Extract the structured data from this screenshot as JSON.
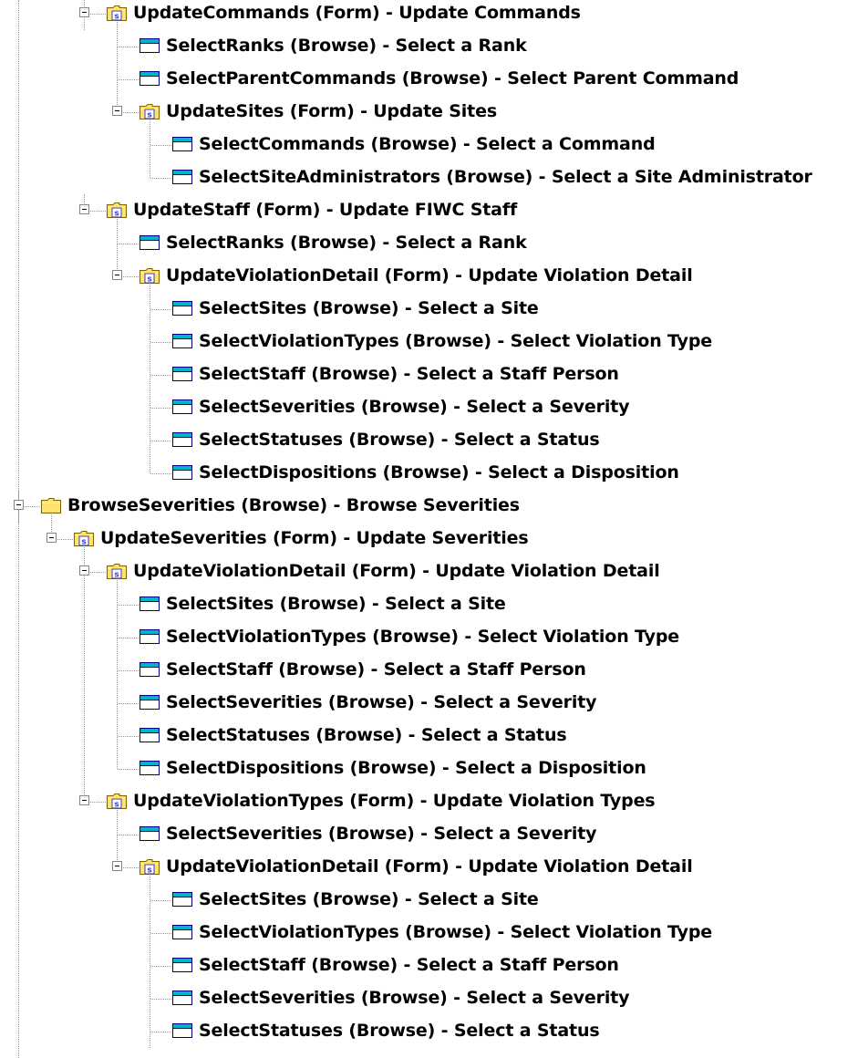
{
  "tree": {
    "nodes": [
      {
        "depth": 3,
        "icon": "form",
        "expanded": true,
        "last": false,
        "label": "UpdateCommands (Form) - Update Commands"
      },
      {
        "depth": 4,
        "icon": "browse",
        "expanded": false,
        "last": false,
        "label": "SelectRanks (Browse) - Select a Rank"
      },
      {
        "depth": 4,
        "icon": "browse",
        "expanded": false,
        "last": false,
        "label": "SelectParentCommands (Browse) - Select Parent Command"
      },
      {
        "depth": 4,
        "icon": "form",
        "expanded": true,
        "last": true,
        "label": "UpdateSites (Form) - Update Sites"
      },
      {
        "depth": 5,
        "icon": "browse",
        "expanded": false,
        "last": false,
        "label": "SelectCommands (Browse) - Select a Command"
      },
      {
        "depth": 5,
        "icon": "browse",
        "expanded": false,
        "last": true,
        "label": "SelectSiteAdministrators (Browse) - Select a Site Administrator"
      },
      {
        "depth": 3,
        "icon": "form",
        "expanded": true,
        "last": true,
        "label": "UpdateStaff (Form) - Update FIWC Staff"
      },
      {
        "depth": 4,
        "icon": "browse",
        "expanded": false,
        "last": false,
        "label": "SelectRanks (Browse) - Select a Rank"
      },
      {
        "depth": 4,
        "icon": "form",
        "expanded": true,
        "last": true,
        "label": "UpdateViolationDetail (Form) - Update Violation Detail"
      },
      {
        "depth": 5,
        "icon": "browse",
        "expanded": false,
        "last": false,
        "label": "SelectSites (Browse) - Select a Site"
      },
      {
        "depth": 5,
        "icon": "browse",
        "expanded": false,
        "last": false,
        "label": "SelectViolationTypes (Browse) - Select Violation Type"
      },
      {
        "depth": 5,
        "icon": "browse",
        "expanded": false,
        "last": false,
        "label": "SelectStaff (Browse) - Select a Staff Person"
      },
      {
        "depth": 5,
        "icon": "browse",
        "expanded": false,
        "last": false,
        "label": "SelectSeverities (Browse) - Select a Severity"
      },
      {
        "depth": 5,
        "icon": "browse",
        "expanded": false,
        "last": false,
        "label": "SelectStatuses (Browse) - Select a Status"
      },
      {
        "depth": 5,
        "icon": "browse",
        "expanded": false,
        "last": true,
        "label": "SelectDispositions (Browse) - Select a Disposition"
      },
      {
        "depth": 1,
        "icon": "folder",
        "expanded": true,
        "last": false,
        "label": "BrowseSeverities (Browse) - Browse Severities"
      },
      {
        "depth": 2,
        "icon": "form",
        "expanded": true,
        "last": true,
        "label": "UpdateSeverities (Form) - Update Severities"
      },
      {
        "depth": 3,
        "icon": "form",
        "expanded": true,
        "last": false,
        "label": "UpdateViolationDetail (Form) - Update Violation Detail"
      },
      {
        "depth": 4,
        "icon": "browse",
        "expanded": false,
        "last": false,
        "label": "SelectSites (Browse) - Select a Site"
      },
      {
        "depth": 4,
        "icon": "browse",
        "expanded": false,
        "last": false,
        "label": "SelectViolationTypes (Browse) - Select Violation Type"
      },
      {
        "depth": 4,
        "icon": "browse",
        "expanded": false,
        "last": false,
        "label": "SelectStaff (Browse) - Select a Staff Person"
      },
      {
        "depth": 4,
        "icon": "browse",
        "expanded": false,
        "last": false,
        "label": "SelectSeverities (Browse) - Select a Severity"
      },
      {
        "depth": 4,
        "icon": "browse",
        "expanded": false,
        "last": false,
        "label": "SelectStatuses (Browse) - Select a Status"
      },
      {
        "depth": 4,
        "icon": "browse",
        "expanded": false,
        "last": true,
        "label": "SelectDispositions (Browse) - Select a Disposition"
      },
      {
        "depth": 3,
        "icon": "form",
        "expanded": true,
        "last": true,
        "label": "UpdateViolationTypes (Form) - Update Violation Types"
      },
      {
        "depth": 4,
        "icon": "browse",
        "expanded": false,
        "last": false,
        "label": "SelectSeverities (Browse) - Select a Severity"
      },
      {
        "depth": 4,
        "icon": "form",
        "expanded": true,
        "last": true,
        "label": "UpdateViolationDetail (Form) - Update Violation Detail"
      },
      {
        "depth": 5,
        "icon": "browse",
        "expanded": false,
        "last": false,
        "label": "SelectSites (Browse) - Select a Site"
      },
      {
        "depth": 5,
        "icon": "browse",
        "expanded": false,
        "last": false,
        "label": "SelectViolationTypes (Browse) - Select Violation Type"
      },
      {
        "depth": 5,
        "icon": "browse",
        "expanded": false,
        "last": false,
        "label": "SelectStaff (Browse) - Select a Staff Person"
      },
      {
        "depth": 5,
        "icon": "browse",
        "expanded": false,
        "last": false,
        "label": "SelectSeverities (Browse) - Select a Severity"
      },
      {
        "depth": 5,
        "icon": "browse",
        "expanded": false,
        "last": false,
        "label": "SelectStatuses (Browse) - Select a Status"
      }
    ]
  },
  "colors": {
    "folder_fill": "#ffe16b",
    "folder_stroke": "#7a6400",
    "form_badge": "#3a3ad0",
    "browse_title": "#00b4c8",
    "browse_border": "#000080"
  }
}
